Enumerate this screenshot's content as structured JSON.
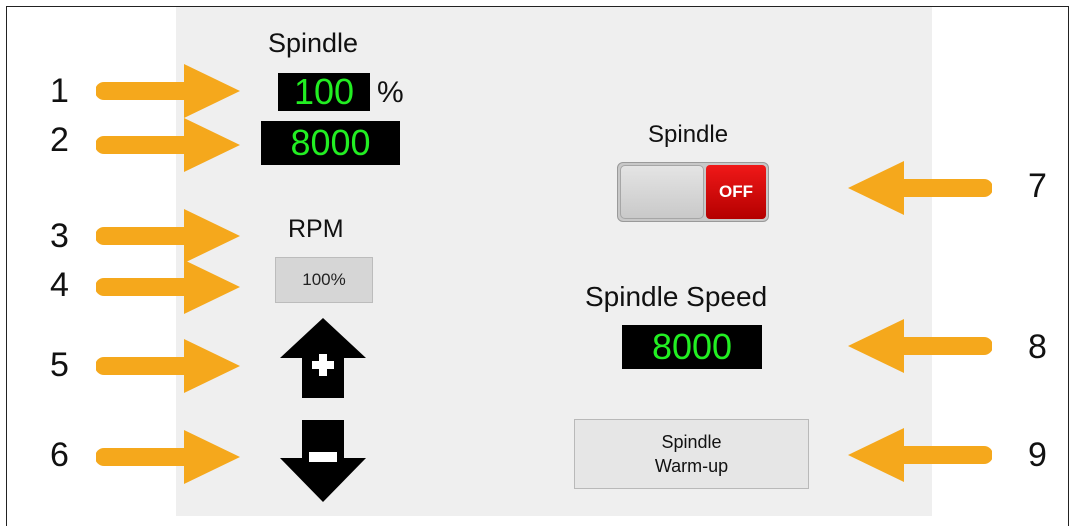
{
  "left_panel": {
    "spindle_title": "Spindle",
    "override_value": "100",
    "percent_sign": "%",
    "rpm_value": "8000",
    "rpm_label": "RPM",
    "reset_button": "100%"
  },
  "right_panel": {
    "toggle_title": "Spindle",
    "toggle_state": "OFF",
    "speed_title": "Spindle Speed",
    "speed_value": "8000",
    "warmup_line1": "Spindle",
    "warmup_line2": "Warm-up"
  },
  "callouts": [
    "1",
    "2",
    "3",
    "4",
    "5",
    "6",
    "7",
    "8",
    "9"
  ],
  "colors": {
    "arrow": "#f5a81c",
    "display_bg": "#000000",
    "display_text": "#22ee22",
    "toggle_off": "#d40000"
  },
  "icons": {
    "increase": "arrow-up-plus-icon",
    "decrease": "arrow-down-minus-icon",
    "callout": "arrow-callout-icon"
  }
}
